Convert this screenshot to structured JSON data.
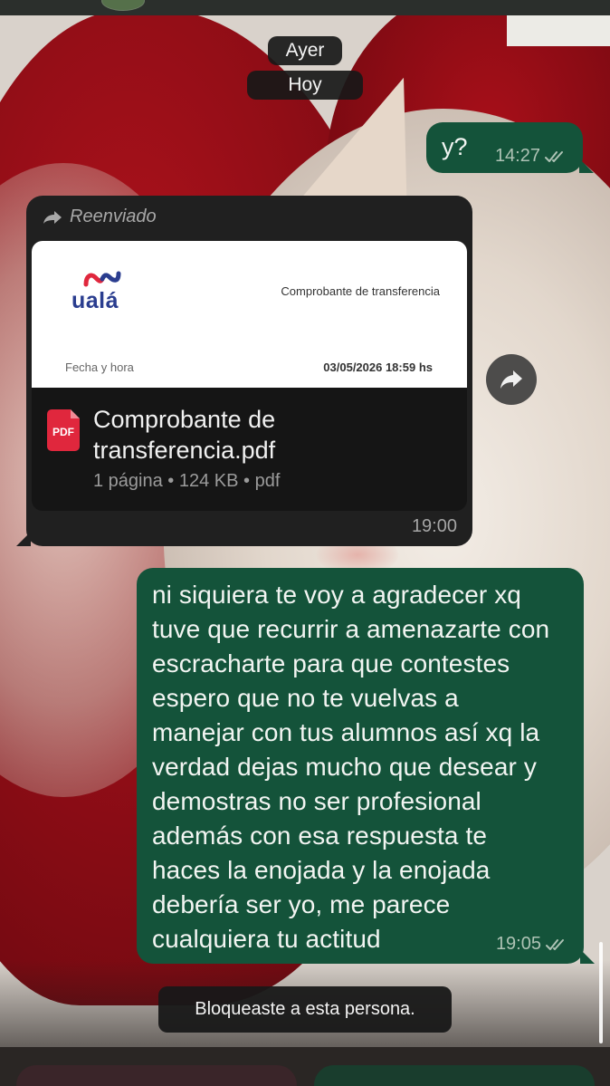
{
  "date_separators": [
    "Ayer",
    "Hoy"
  ],
  "messages": {
    "first": {
      "text": "y?",
      "time": "14:27",
      "status": "read"
    },
    "forwarded_doc": {
      "forwarded_label": "Reenviado",
      "preview": {
        "brand": "ualá",
        "header": "Comprobante de transferencia",
        "field_label": "Fecha y hora",
        "field_value": "03/05/2026 18:59 hs"
      },
      "file_badge": "PDF",
      "file_name": "Comprobante de transferencia.pdf",
      "file_details": "1 página • 124 KB • pdf",
      "time": "19:00"
    },
    "long": {
      "text": "ni siquiera te voy a agradecer xq\ntuve que recurrir a amenazarte con\nescracharte  para que contestes\nespero que no te vuelvas a\nmanejar con tus alumnos así xq la\nverdad dejas mucho que desear y\ndemostras no ser profesional\nademás con esa respuesta te\nhaces la enojada y la enojada\ndebería ser yo, me parece\ncualquiera tu actitud",
      "time": "19:05",
      "status": "read"
    }
  },
  "system_notice": "Bloqueaste a esta persona.",
  "icons": {
    "forward": "forward-arrow-icon",
    "share": "share-icon",
    "read": "double-check-icon",
    "pdf": "pdf-file-icon"
  },
  "colors": {
    "outgoing_bubble": "#14533a",
    "incoming_bubble": "#202020",
    "brand_blue": "#2a3d8f",
    "brand_red": "#e0273d",
    "pdf_red": "#e0273d"
  }
}
